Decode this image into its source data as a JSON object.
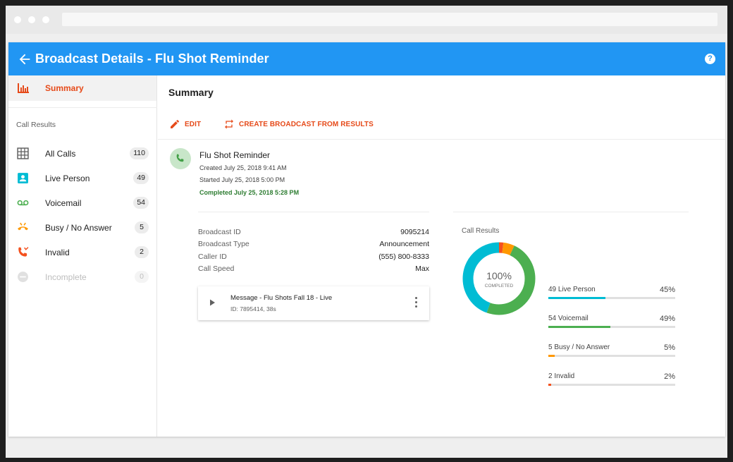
{
  "app": {
    "title": "Broadcast Details - Flu Shot Reminder",
    "help_symbol": "?"
  },
  "sidebar": {
    "summary_label": "Summary",
    "section_title": "Call Results",
    "items": [
      {
        "label": "All Calls",
        "count": "110",
        "icon": "grid-icon",
        "color": "#616161"
      },
      {
        "label": "Live Person",
        "count": "49",
        "icon": "person-icon",
        "color": "#00bcd4"
      },
      {
        "label": "Voicemail",
        "count": "54",
        "icon": "voicemail-icon",
        "color": "#4caf50"
      },
      {
        "label": "Busy / No Answer",
        "count": "5",
        "icon": "phone-hangup-icon",
        "color": "#ff9800"
      },
      {
        "label": "Invalid",
        "count": "2",
        "icon": "phone-missed-icon",
        "color": "#f4511e"
      },
      {
        "label": "Incomplete",
        "count": "0",
        "icon": "minus-circle-icon",
        "color": "#e0e0e0"
      }
    ]
  },
  "main": {
    "title": "Summary",
    "edit_label": "EDIT",
    "create_label": "CREATE BROADCAST FROM RESULTS",
    "broadcast": {
      "name": "Flu Shot Reminder",
      "created": "Created July 25, 2018 9:41 AM",
      "started": "Started July 25, 2018 5:00 PM",
      "completed": "Completed July 25, 2018 5:28 PM"
    },
    "details": [
      {
        "key": "Broadcast ID",
        "value": "9095214"
      },
      {
        "key": "Broadcast Type",
        "value": "Announcement"
      },
      {
        "key": "Caller ID",
        "value": "(555) 800-8333"
      },
      {
        "key": "Call Speed",
        "value": "Max"
      }
    ],
    "message": {
      "title": "Message - Flu Shots Fall 18 - Live",
      "subtitle": "ID: 7895414, 38s"
    },
    "results": {
      "label": "Call Results",
      "center_value": "100%",
      "center_label": "COMPLETED",
      "rows": [
        {
          "label": "49 Live Person",
          "pct_text": "45%",
          "fraction": 0.45,
          "color": "#00bcd4"
        },
        {
          "label": "54 Voicemail",
          "pct_text": "49%",
          "fraction": 0.49,
          "color": "#4caf50"
        },
        {
          "label": "5 Busy / No Answer",
          "pct_text": "5%",
          "fraction": 0.05,
          "color": "#ff9800"
        },
        {
          "label": "2 Invalid",
          "pct_text": "2%",
          "fraction": 0.02,
          "color": "#f4511e"
        }
      ]
    }
  }
}
